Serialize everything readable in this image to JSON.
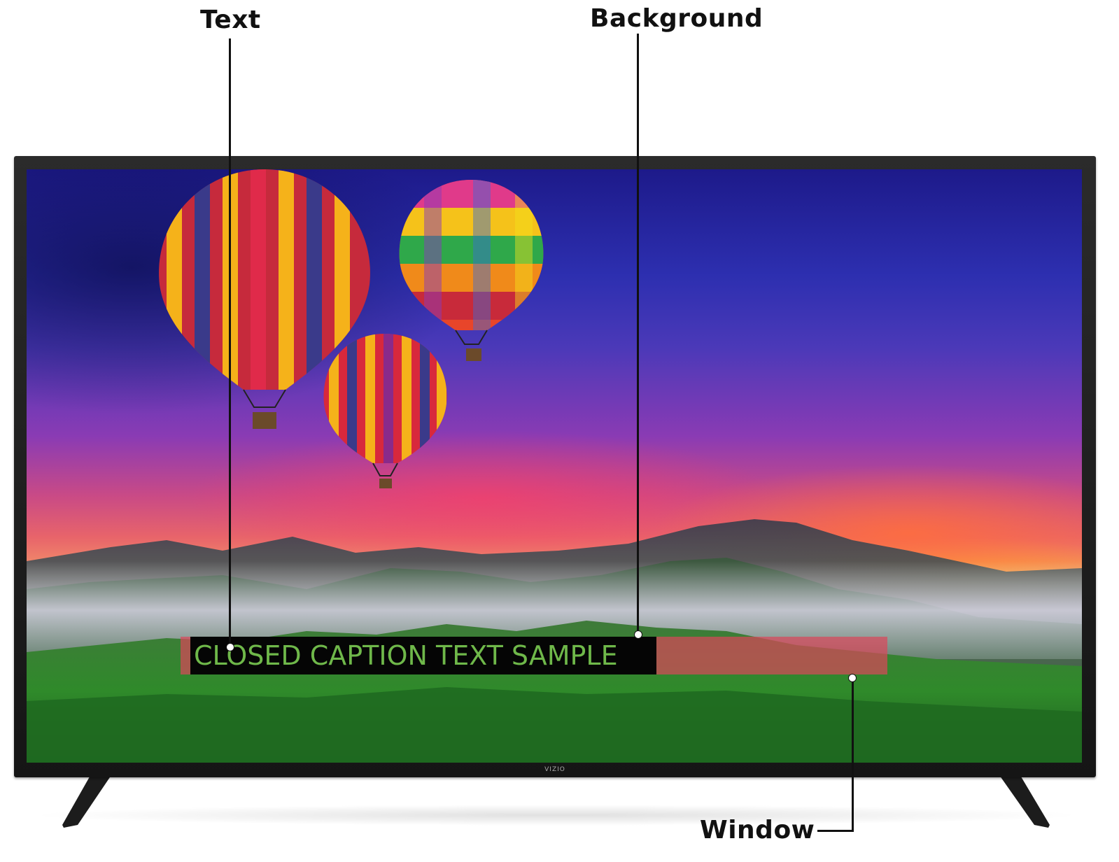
{
  "callouts": {
    "text_label": "Text",
    "background_label": "Background",
    "window_label": "Window"
  },
  "caption": {
    "sample_text": "CLOSED CAPTION TEXT SAMPLE",
    "text_color": "#6fb84a",
    "background_color": "#050505",
    "window_color": "#dc465a"
  },
  "tv": {
    "brand_logo": "VIZIO"
  },
  "icons": {
    "balloon": "hot-air-balloon-icon"
  }
}
